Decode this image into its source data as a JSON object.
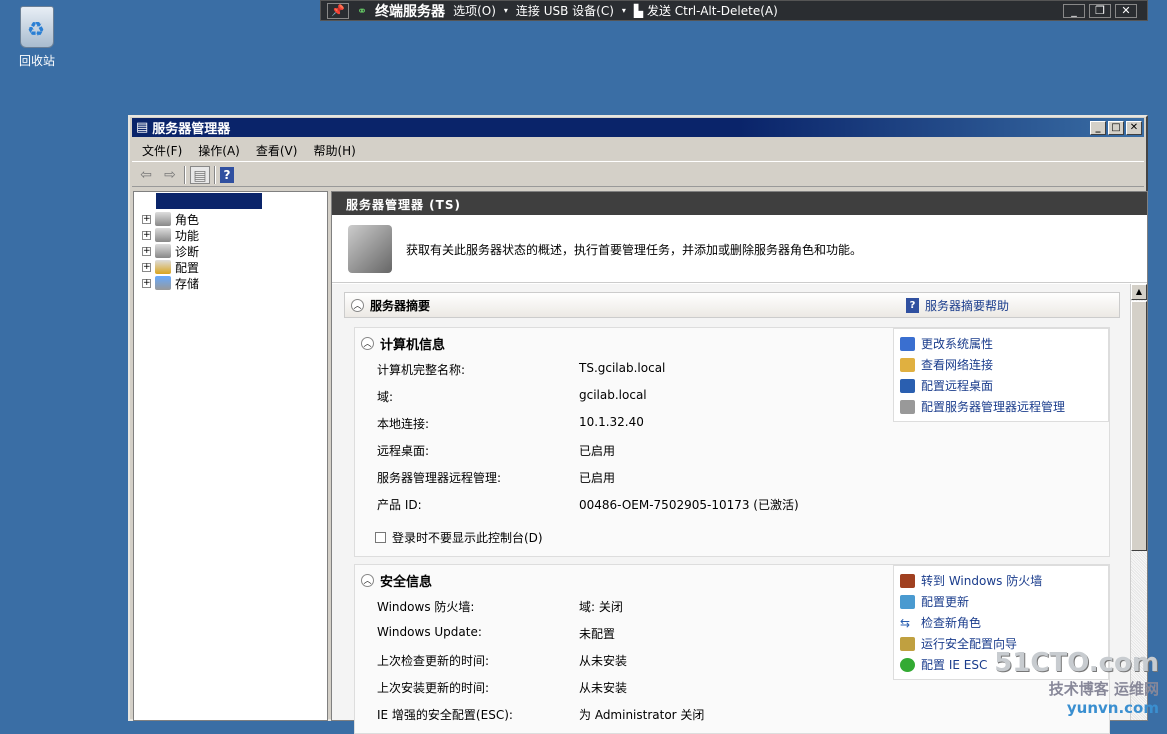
{
  "desktop": {
    "recycle_bin": "回收站"
  },
  "rdp_bar": {
    "title": "终端服务器",
    "options": "选项(O)",
    "usb": "连接 USB 设备(C)",
    "send": "发送 Ctrl-Alt-Delete(A)"
  },
  "window": {
    "title": "服务器管理器",
    "menu": [
      "文件(F)",
      "操作(A)",
      "查看(V)",
      "帮助(H)"
    ]
  },
  "tree": {
    "items": [
      "角色",
      "功能",
      "诊断",
      "配置",
      "存储"
    ]
  },
  "main": {
    "header": "服务器管理器 (TS)",
    "description": "获取有关此服务器状态的概述，执行首要管理任务，并添加或删除服务器角色和功能。",
    "summary": {
      "title": "服务器摘要",
      "help": "服务器摘要帮助"
    },
    "computer_info": {
      "title": "计算机信息",
      "rows": [
        {
          "k": "计算机完整名称:",
          "v": "TS.gcilab.local"
        },
        {
          "k": "域:",
          "v": "gcilab.local"
        },
        {
          "k": "本地连接:",
          "v": "10.1.32.40"
        },
        {
          "k": "远程桌面:",
          "v": "已启用"
        },
        {
          "k": "服务器管理器远程管理:",
          "v": "已启用"
        },
        {
          "k": "产品 ID:",
          "v": "00486-OEM-7502905-10173 (已激活)"
        }
      ],
      "checkbox": "登录时不要显示此控制台(D)",
      "checkbox_checked": false,
      "links": [
        "更改系统属性",
        "查看网络连接",
        "配置远程桌面",
        "配置服务器管理器远程管理"
      ]
    },
    "security_info": {
      "title": "安全信息",
      "rows": [
        {
          "k": "Windows 防火墙:",
          "v": "域: 关闭"
        },
        {
          "k": "Windows Update:",
          "v": "未配置"
        },
        {
          "k": "上次检查更新的时间:",
          "v": "从未安装"
        },
        {
          "k": "上次安装更新的时间:",
          "v": "从未安装"
        },
        {
          "k": "IE 增强的安全配置(ESC):",
          "v": "为 Administrator 关闭"
        }
      ],
      "links": [
        "转到 Windows 防火墙",
        "配置更新",
        "检查新角色",
        "运行安全配置向导",
        "配置 IE ESC"
      ]
    }
  },
  "watermark": {
    "line1": "51CTO.com",
    "line2": "技术博客 运维网",
    "line3": "yunvn.com"
  }
}
